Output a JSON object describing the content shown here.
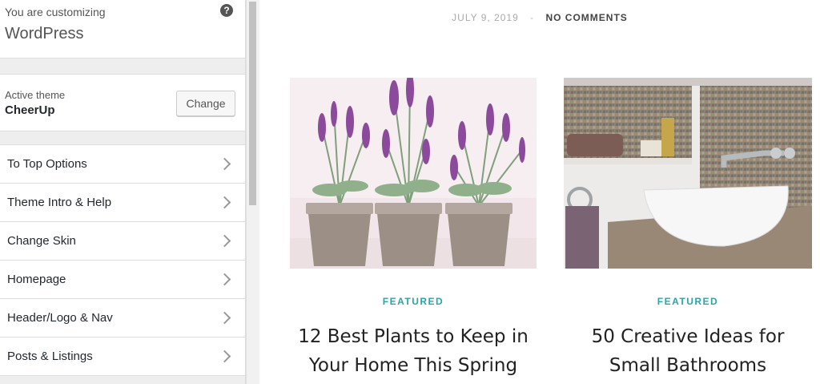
{
  "customizer": {
    "subtitle": "You are customizing",
    "title": "WordPress",
    "help_icon": "?"
  },
  "active_theme": {
    "label": "Active theme",
    "name": "CheerUp",
    "change_label": "Change"
  },
  "sections": [
    {
      "label": "To Top Options"
    },
    {
      "label": "Theme Intro & Help"
    },
    {
      "label": "Change Skin"
    },
    {
      "label": "Homepage"
    },
    {
      "label": "Header/Logo & Nav"
    },
    {
      "label": "Posts & Listings"
    }
  ],
  "post_meta": {
    "date": "JULY 9, 2019",
    "separator": "-",
    "comments": "NO COMMENTS"
  },
  "posts": [
    {
      "category": "FEATURED",
      "title_line1": "12 Best Plants to Keep in",
      "title_line2": "Your Home This Spring"
    },
    {
      "category": "FEATURED",
      "title_line1": "50 Creative Ideas for",
      "title_line2": "Small Bathrooms"
    }
  ],
  "colors": {
    "accent": "#2da5a5",
    "lavender": "#8b4a9c",
    "pot": "#9c8f86"
  }
}
